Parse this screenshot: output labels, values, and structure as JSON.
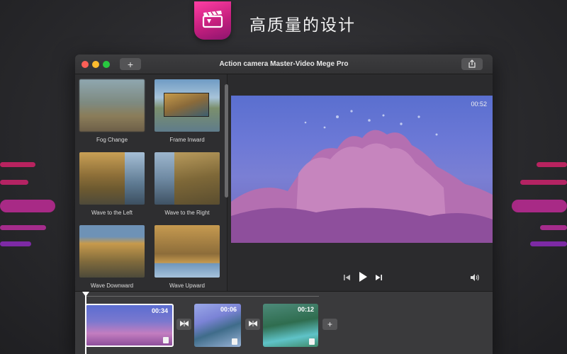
{
  "promo": {
    "title": "高质量的设计"
  },
  "window": {
    "title": "Action camera Master-Video Mege Pro",
    "add_label": "+",
    "share_icon": "share-icon"
  },
  "transitions": [
    {
      "label": "Fog Change"
    },
    {
      "label": "Frame Inward"
    },
    {
      "label": "Wave to the Left"
    },
    {
      "label": "Wave to the Right"
    },
    {
      "label": "Wave Downward"
    },
    {
      "label": "Wave Upward"
    }
  ],
  "preview": {
    "time": "00:52",
    "controls": [
      "skip-back-icon",
      "play-icon",
      "skip-forward-icon"
    ],
    "volume_icon": "speaker-icon"
  },
  "timeline": {
    "clips": [
      {
        "duration": "00:34"
      },
      {
        "duration": "00:06"
      },
      {
        "duration": "00:12"
      }
    ],
    "add_label": "+"
  },
  "colors": {
    "accent": "#e0287f",
    "window_bg": "#2b2b2d",
    "stripe_magenta": "#c4246e",
    "stripe_purple": "#9b2fa8"
  }
}
